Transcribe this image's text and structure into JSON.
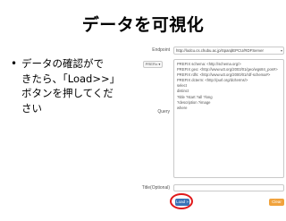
{
  "slide": {
    "title": "データを可視化",
    "bullet_marker": "•",
    "bullet_lines": [
      "データの確認がで",
      "きたら、「Load>>」",
      "ボタンを押してくだ",
      "さい"
    ]
  },
  "form": {
    "endpoint_label": "Endpoint",
    "endpoint_value": "http://lodcu.cs.chubu.ac.jp/SparqlEPCU/RDFServer",
    "prefix_button": "PREFix ▾",
    "query_label": "Query",
    "query_lines": [
      "PREFIX schema: <http://schema.org/>",
      "PREFIX geo: <http://www.w3.org/2003/01/geo/wgs84_pos#>",
      "PREFIX rdfs: <http://www.w3.org/2000/01/rdf-schema#>",
      "PREFIX dcterm: <http://purl.org/dc/terms/>",
      "select",
      "distinct",
      "?title ?start ?all ?long",
      "?description ?image",
      "where"
    ],
    "title_label": "Title(Optional)",
    "title_value": "",
    "load_button": "Load »",
    "clear_button": "Clear"
  },
  "colors": {
    "load_button": "#3a73b7",
    "clear_button": "#f0a23c",
    "highlight_circle": "#e0191b"
  }
}
